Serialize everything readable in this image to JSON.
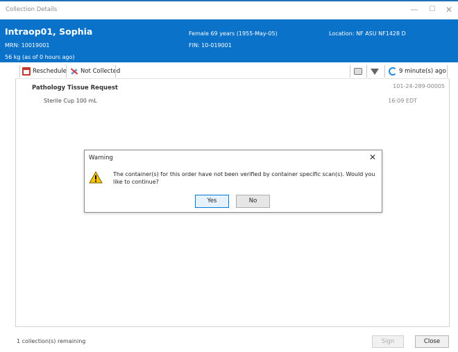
{
  "window": {
    "title": "Collection Details",
    "minimize_glyph": "—",
    "maximize_glyph": "☐",
    "close_glyph": "✕"
  },
  "patient": {
    "name": "Intraop01, Sophia",
    "mrn": "MRN: 10019001",
    "weight": "56 kg (as of 0 hours ago)",
    "demographics": "Female 69 years (1955-May-05)",
    "fin": "FIN: 10-019001",
    "location": "Location: NF ASU NF1428 D"
  },
  "toolbar": {
    "reschedule_label": "Reschedule",
    "not_collected_label": "Not Collected",
    "refresh_label": "9 minute(s) ago"
  },
  "order": {
    "title": "Pathology Tissue Request",
    "accession": "101-24-289-00005",
    "container": "Sterile Cup 100 mL",
    "time": "16:09 EDT"
  },
  "dialog": {
    "title": "Warning",
    "close_glyph": "✕",
    "message": "The container(s) for this order have not been verified by container specific scan(s). Would you like to continue?",
    "yes_label": "Yes",
    "no_label": "No"
  },
  "footer": {
    "status": "1 collection(s) remaining",
    "sign_label": "Sign",
    "close_label": "Close"
  },
  "colors": {
    "banner": "#0a72c8",
    "accent": "#0078d7",
    "warning": "#f5c400"
  }
}
